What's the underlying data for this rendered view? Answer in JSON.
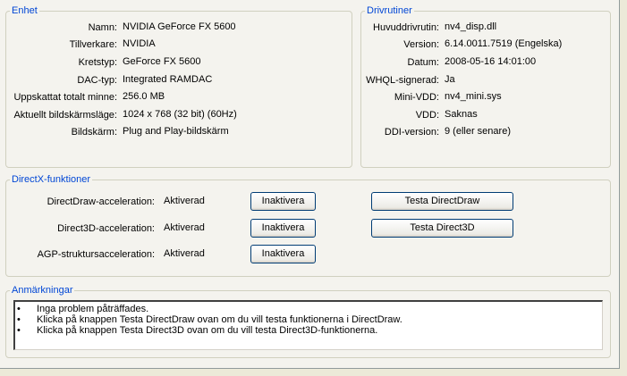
{
  "device": {
    "legend": "Enhet",
    "rows": [
      {
        "label": "Namn:",
        "value": "NVIDIA GeForce FX 5600"
      },
      {
        "label": "Tillverkare:",
        "value": "NVIDIA"
      },
      {
        "label": "Kretstyp:",
        "value": "GeForce FX 5600"
      },
      {
        "label": "DAC-typ:",
        "value": "Integrated RAMDAC"
      },
      {
        "label": "Uppskattat totalt minne:",
        "value": "256.0 MB"
      },
      {
        "label": "Aktuellt bildskärmsläge:",
        "value": "1024 x 768 (32 bit) (60Hz)"
      },
      {
        "label": "Bildskärm:",
        "value": "Plug and Play-bildskärm"
      }
    ]
  },
  "drivers": {
    "legend": "Drivrutiner",
    "rows": [
      {
        "label": "Huvuddrivrutin:",
        "value": "nv4_disp.dll"
      },
      {
        "label": "Version:",
        "value": "6.14.0011.7519 (Engelska)"
      },
      {
        "label": "Datum:",
        "value": "2008-05-16 14:01:00"
      },
      {
        "label": "WHQL-signerad:",
        "value": "Ja"
      },
      {
        "label": "Mini-VDD:",
        "value": "nv4_mini.sys"
      },
      {
        "label": "VDD:",
        "value": "Saknas"
      },
      {
        "label": "DDI-version:",
        "value": "9 (eller senare)"
      }
    ]
  },
  "directx": {
    "legend": "DirectX-funktioner",
    "features": [
      {
        "label": "DirectDraw-acceleration:",
        "status": "Aktiverad",
        "toggle": "Inaktivera",
        "test": "Testa DirectDraw"
      },
      {
        "label": "Direct3D-acceleration:",
        "status": "Aktiverad",
        "toggle": "Inaktivera",
        "test": "Testa Direct3D"
      },
      {
        "label": "AGP-struktursacceleration:",
        "status": "Aktiverad",
        "toggle": "Inaktivera"
      }
    ]
  },
  "notes": {
    "legend": "Anmärkningar",
    "bullet": "•",
    "items": [
      "Inga problem påträffades.",
      "Klicka på knappen Testa DirectDraw ovan om du vill testa funktionerna i DirectDraw.",
      "Klicka på knappen Testa Direct3D ovan om du vill testa Direct3D-funktionerna."
    ]
  }
}
